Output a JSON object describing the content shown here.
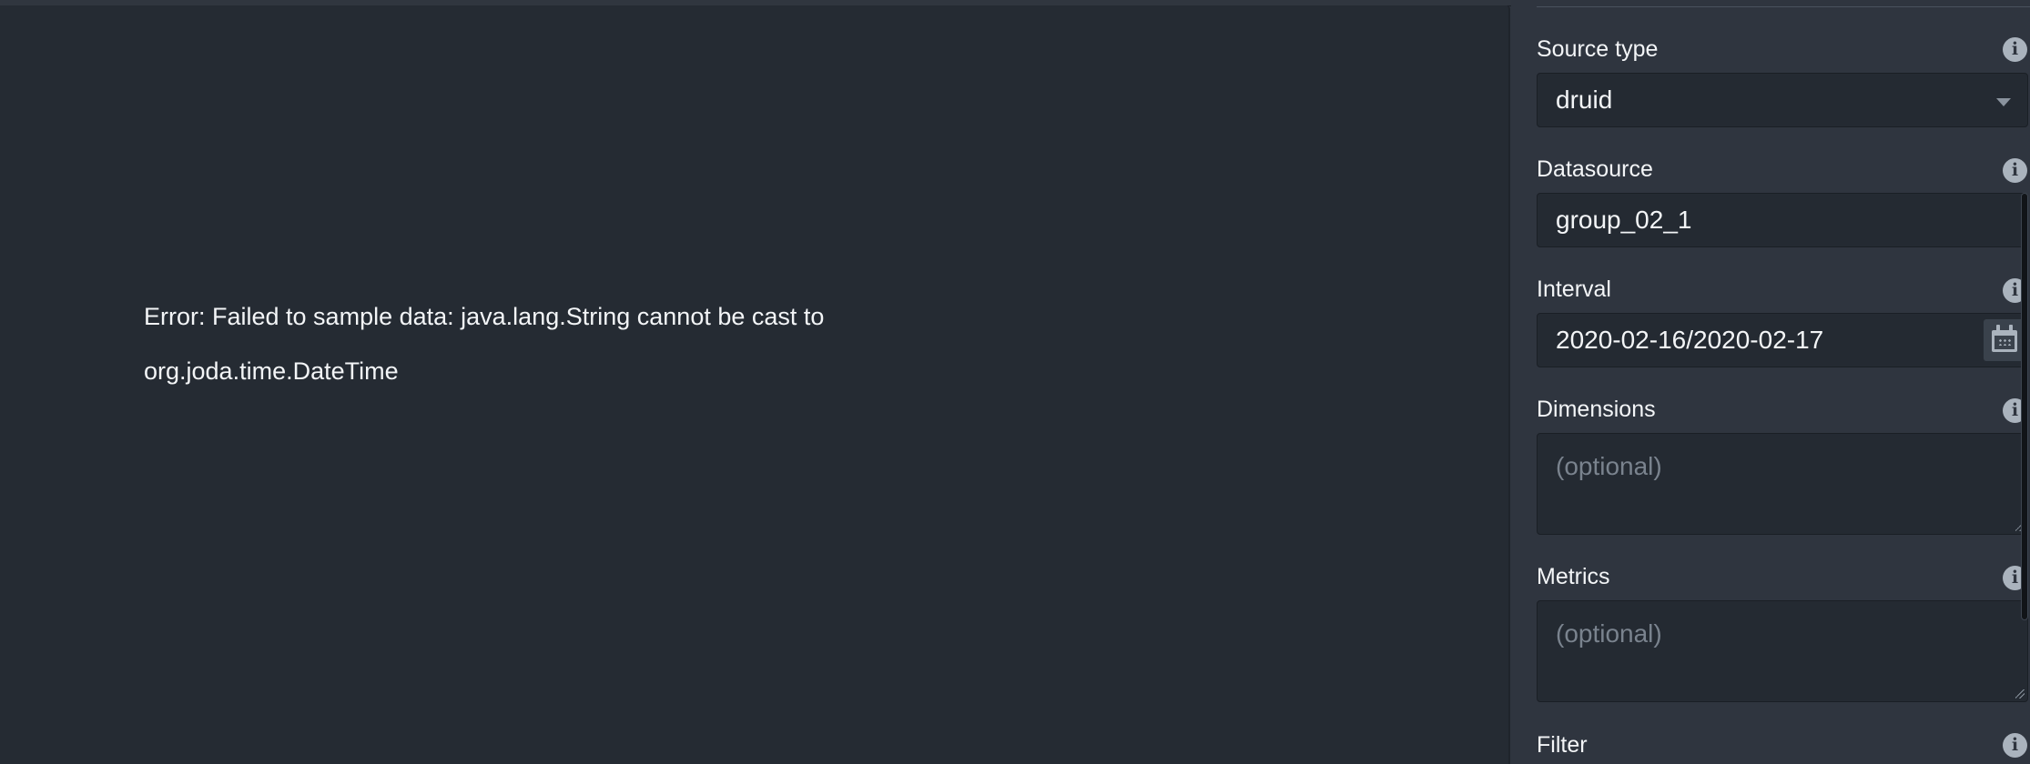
{
  "error": {
    "line1": "Error: Failed to sample data: java.lang.String cannot be cast to",
    "line2": "org.joda.time.DateTime"
  },
  "form": {
    "source_type": {
      "label": "Source type",
      "value": "druid"
    },
    "datasource": {
      "label": "Datasource",
      "value": "group_02_1"
    },
    "interval": {
      "label": "Interval",
      "value": "2020-02-16/2020-02-17"
    },
    "dimensions": {
      "label": "Dimensions",
      "placeholder": "(optional)"
    },
    "metrics": {
      "label": "Metrics",
      "placeholder": "(optional)"
    },
    "filter": {
      "label": "Filter"
    },
    "info_glyph": "i"
  },
  "icons": {
    "info": "info-icon",
    "dropdown": "chevron-down-icon",
    "calendar": "calendar-icon"
  }
}
